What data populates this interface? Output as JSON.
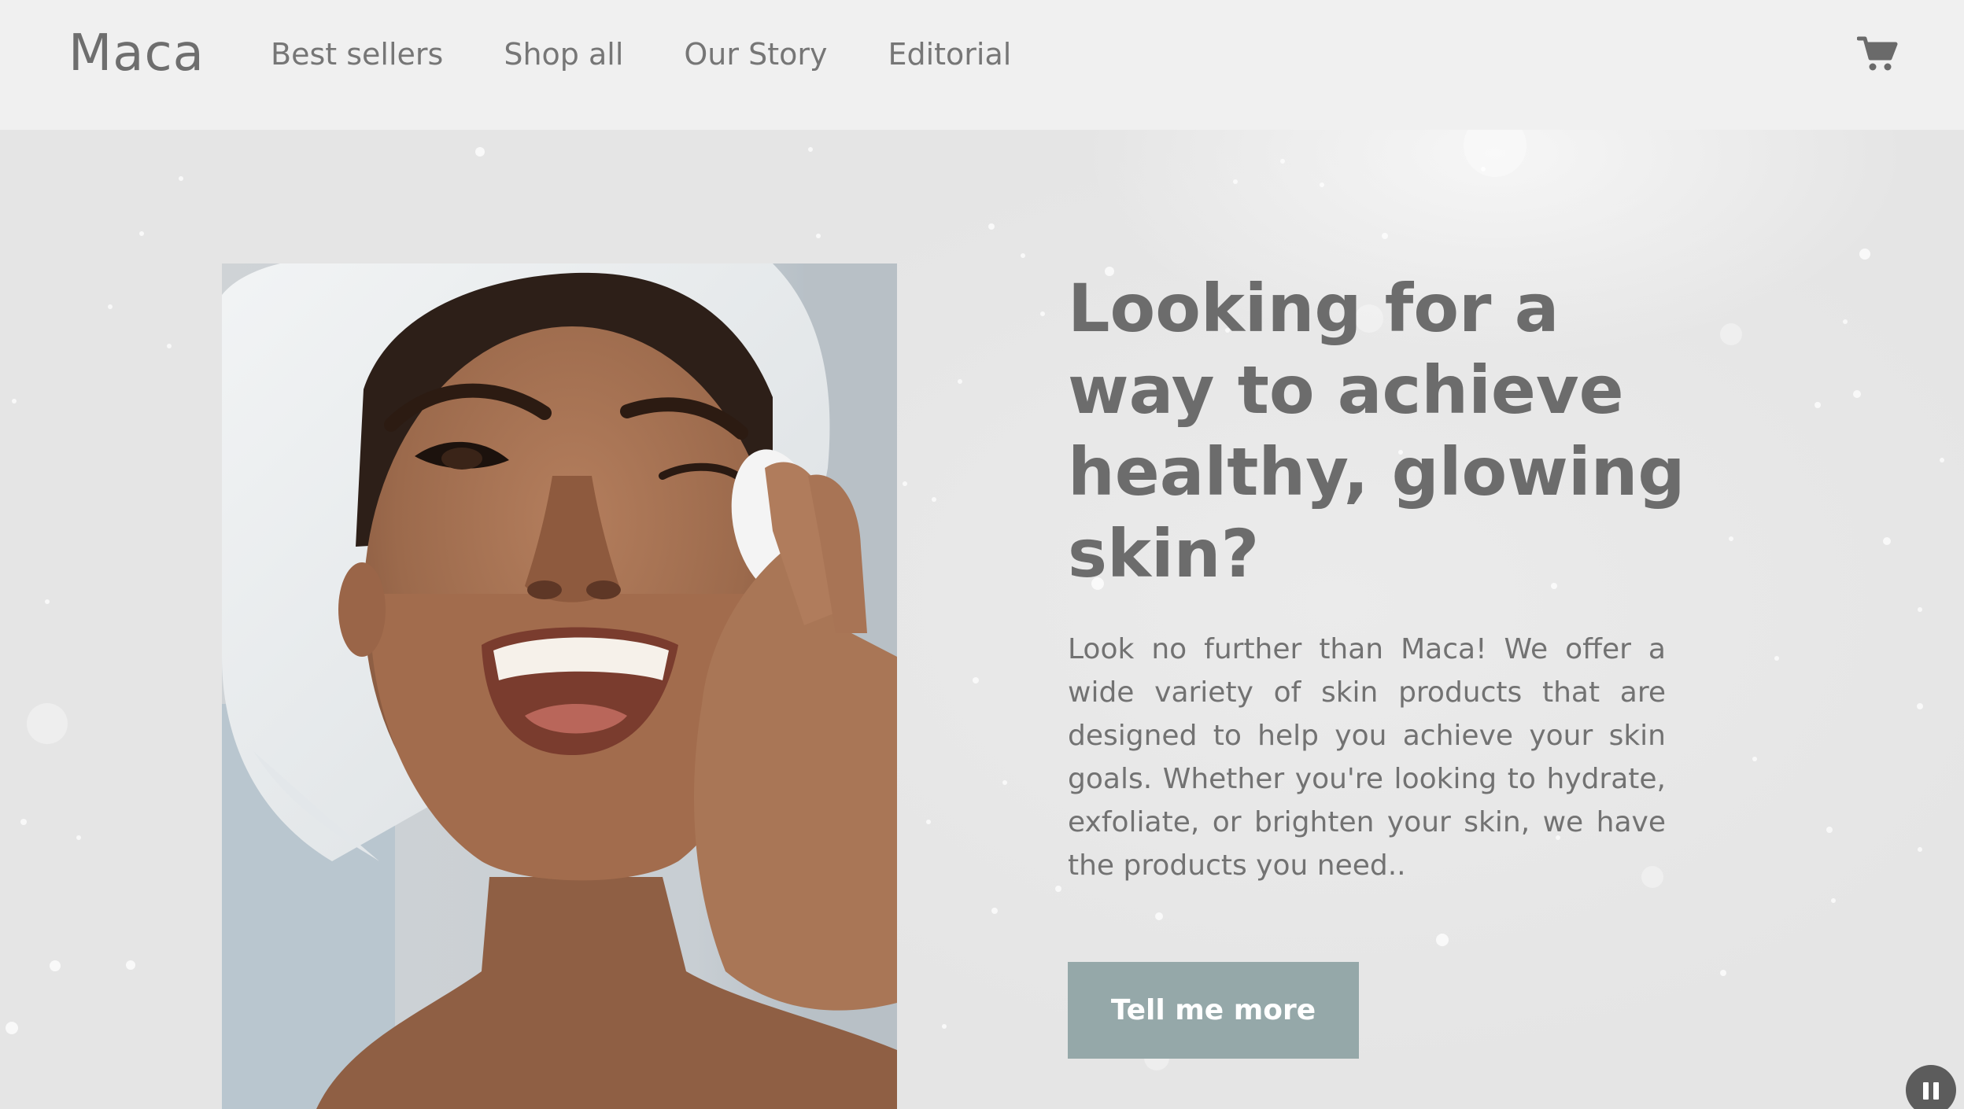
{
  "brand": {
    "logo": "Maca"
  },
  "nav": {
    "items": [
      {
        "label": "Best sellers"
      },
      {
        "label": "Shop all"
      },
      {
        "label": "Our Story"
      },
      {
        "label": "Editorial"
      }
    ],
    "cart_icon": "shopping-cart-icon"
  },
  "hero": {
    "image_alt": "smiling woman with towel on head applying cotton pad",
    "headline": "Looking for a way to achieve healthy, glowing skin?",
    "body": "Look no further than Maca! We offer a wide variety of skin products that are designed to help you achieve your skin goals. Whether you're looking to hydrate, exfoliate, or brighten your skin, we have the products you need..",
    "cta_label": "Tell me more",
    "pause_icon": "pause-icon"
  },
  "colors": {
    "header_bg": "#f0f0f0",
    "page_bg": "#e5e5e5",
    "text": "#6c6c6c",
    "cta_bg": "#95a8a9",
    "cta_text": "#ffffff",
    "pause_bg": "#5c5c5c"
  }
}
